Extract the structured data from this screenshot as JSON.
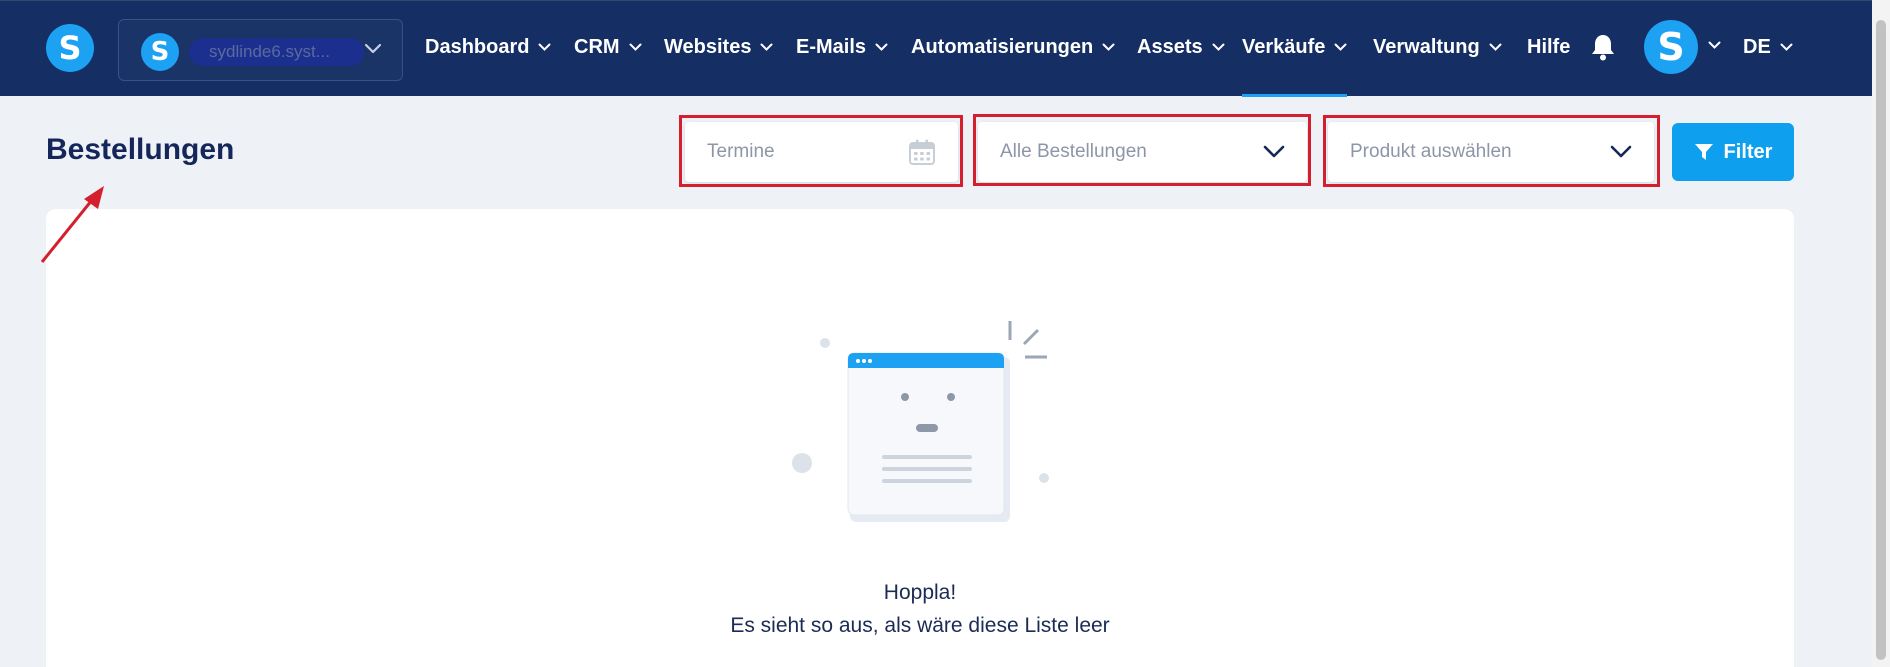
{
  "brand": {
    "logo_letter": "S"
  },
  "site_switcher": {
    "avatar_letter": "S",
    "site_name": "sydlinde6.syst..."
  },
  "nav": {
    "items": [
      {
        "label": "Dashboard"
      },
      {
        "label": "CRM"
      },
      {
        "label": "Websites"
      },
      {
        "label": "E-Mails"
      },
      {
        "label": "Automatisierungen"
      },
      {
        "label": "Assets"
      },
      {
        "label": "Verkäufe",
        "active": true
      },
      {
        "label": "Verwaltung"
      }
    ],
    "help": "Hilfe",
    "notifications_icon": "bell-icon",
    "user_avatar_letter": "S",
    "language": "DE"
  },
  "page": {
    "title": "Bestellungen"
  },
  "filters": {
    "date_placeholder": "Termine",
    "orders_select": "Alle Bestellungen",
    "product_select": "Produkt auswählen",
    "filter_button": "Filter"
  },
  "empty_state": {
    "title": "Hoppla!",
    "subtitle": "Es sieht so aus, als wäre diese Liste leer"
  },
  "colors": {
    "nav_bg": "#152e63",
    "accent": "#1da1f2",
    "highlight": "#d4202e",
    "page_bg": "#eef2f7"
  }
}
